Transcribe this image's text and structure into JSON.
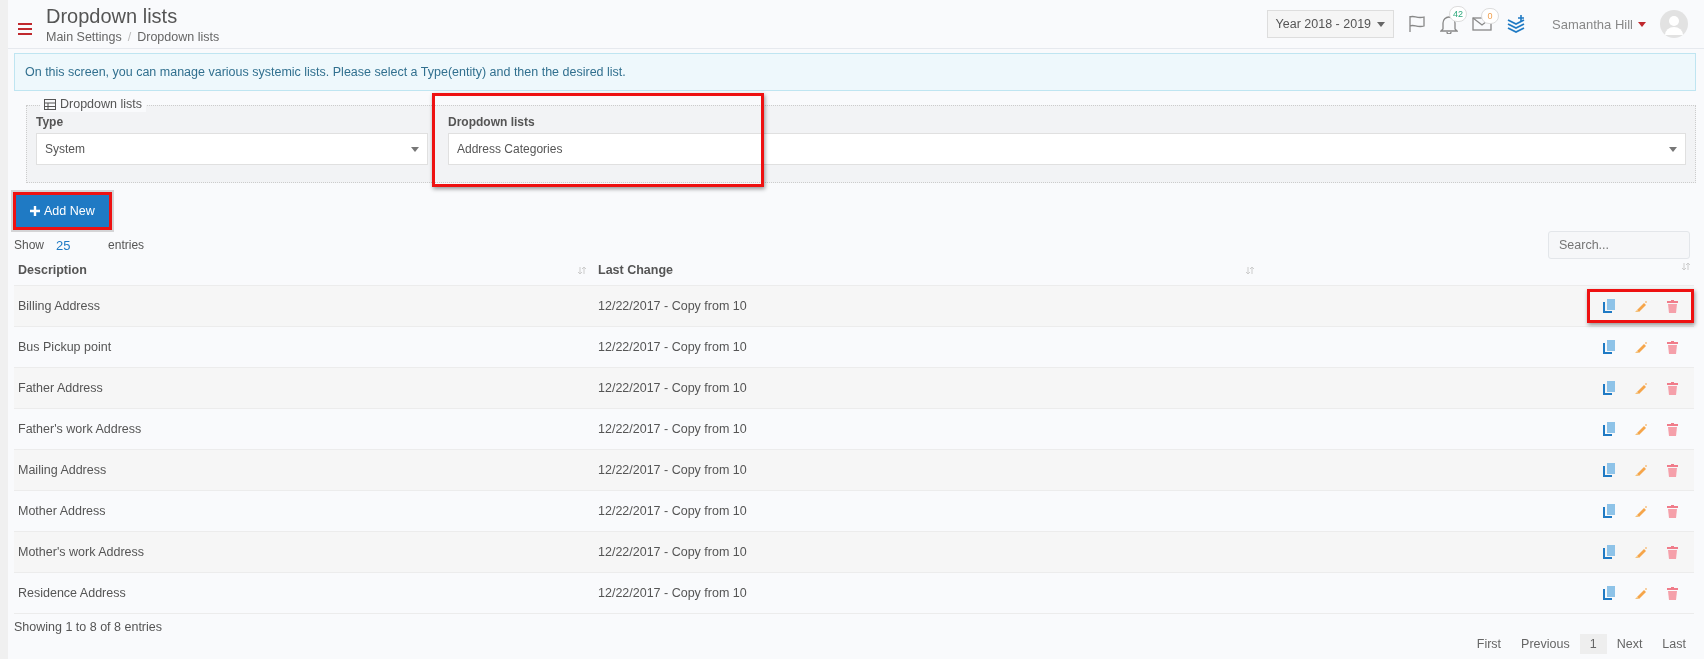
{
  "header": {
    "title": "Dropdown lists",
    "breadcrumb": [
      "Main Settings",
      "Dropdown lists"
    ],
    "breadcrumb_separator": "/",
    "year_selector": "Year 2018 - 2019",
    "notifications_count": "42",
    "messages_count": "0",
    "user_name": "Samantha Hill"
  },
  "info_message": "On this screen, you can manage various systemic lists. Please select a Type(entity) and then the desired list.",
  "filter_panel": {
    "legend": "Dropdown lists",
    "fields": [
      {
        "label": "Type",
        "value": "System",
        "highlighted": false
      },
      {
        "label": "Dropdown lists",
        "value": "Address Categories",
        "highlighted": true
      }
    ]
  },
  "add_button": {
    "label": "Add New",
    "highlighted": true
  },
  "table_controls": {
    "show_label": "Show",
    "page_size": "25",
    "entries_label": "entries",
    "search_placeholder": "Search..."
  },
  "table": {
    "columns": [
      "Description",
      "Last Change"
    ],
    "rows": [
      {
        "description": "Billing Address",
        "last_change": "12/22/2017 - Copy from 10",
        "highlighted": true
      },
      {
        "description": "Bus Pickup point",
        "last_change": "12/22/2017 - Copy from 10",
        "highlighted": false
      },
      {
        "description": "Father Address",
        "last_change": "12/22/2017 - Copy from 10",
        "highlighted": false
      },
      {
        "description": "Father's work Address",
        "last_change": "12/22/2017 - Copy from 10",
        "highlighted": false
      },
      {
        "description": "Mailing Address",
        "last_change": "12/22/2017 - Copy from 10",
        "highlighted": false
      },
      {
        "description": "Mother Address",
        "last_change": "12/22/2017 - Copy from 10",
        "highlighted": false
      },
      {
        "description": "Mother's work Address",
        "last_change": "12/22/2017 - Copy from 10",
        "highlighted": false
      },
      {
        "description": "Residence Address",
        "last_change": "12/22/2017 - Copy from 10",
        "highlighted": false
      }
    ]
  },
  "footer": {
    "summary": "Showing 1 to 8 of 8 entries",
    "pagination": [
      {
        "label": "First",
        "selected": false
      },
      {
        "label": "Previous",
        "selected": false
      },
      {
        "label": "1",
        "selected": true
      },
      {
        "label": "Next",
        "selected": false
      },
      {
        "label": "Last",
        "selected": false
      }
    ]
  }
}
